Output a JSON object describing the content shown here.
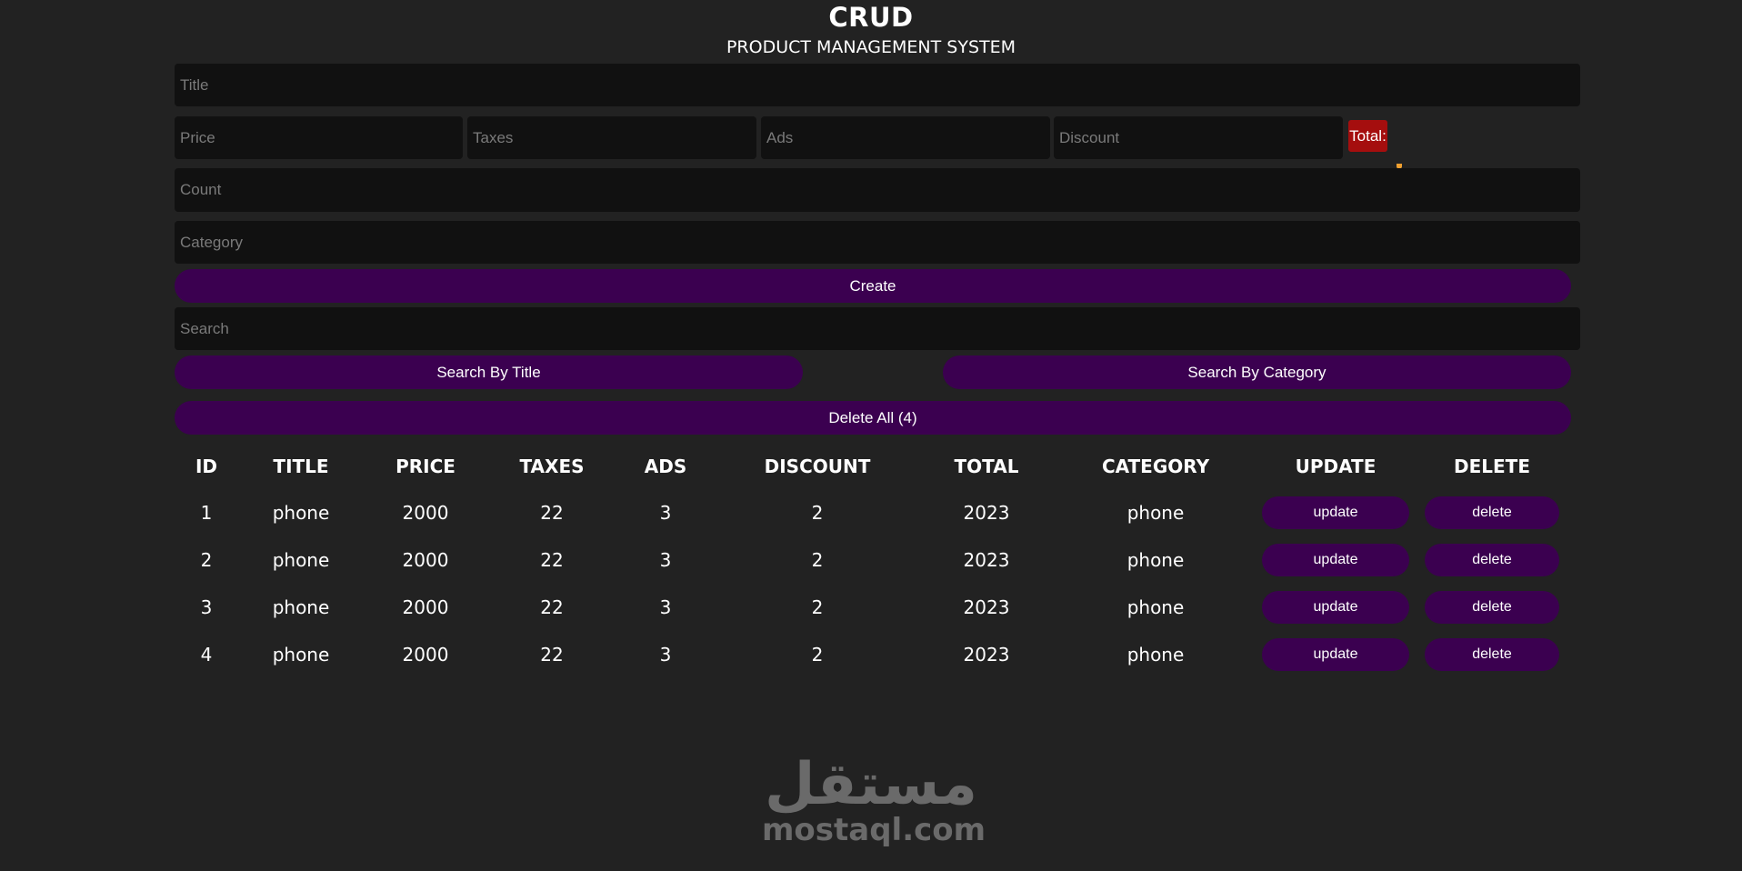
{
  "header": {
    "title": "CRUD",
    "subtitle": "PRODUCT MANAGEMENT SYSTEM"
  },
  "form": {
    "title_placeholder": "Title",
    "price_placeholder": "Price",
    "taxes_placeholder": "Taxes",
    "ads_placeholder": "Ads",
    "discount_placeholder": "Discount",
    "total_label": "Total:",
    "count_placeholder": "Count",
    "category_placeholder": "Category",
    "create_label": "Create"
  },
  "search": {
    "placeholder": "Search",
    "by_title_label": "Search By Title",
    "by_category_label": "Search By Category"
  },
  "delete_all_label": "Delete All (4)",
  "table": {
    "headers": [
      "ID",
      "TITLE",
      "PRICE",
      "TAXES",
      "ADS",
      "DISCOUNT",
      "TOTAL",
      "CATEGORY",
      "UPDATE",
      "DELETE"
    ],
    "update_label": "update",
    "delete_label": "delete",
    "rows": [
      {
        "id": "1",
        "title": "phone",
        "price": "2000",
        "taxes": "22",
        "ads": "3",
        "discount": "2",
        "total": "2023",
        "category": "phone"
      },
      {
        "id": "2",
        "title": "phone",
        "price": "2000",
        "taxes": "22",
        "ads": "3",
        "discount": "2",
        "total": "2023",
        "category": "phone"
      },
      {
        "id": "3",
        "title": "phone",
        "price": "2000",
        "taxes": "22",
        "ads": "3",
        "discount": "2",
        "total": "2023",
        "category": "phone"
      },
      {
        "id": "4",
        "title": "phone",
        "price": "2000",
        "taxes": "22",
        "ads": "3",
        "discount": "2",
        "total": "2023",
        "category": "phone"
      }
    ]
  },
  "watermark": {
    "arabic": "مستقل",
    "latin": "mostaql.com"
  },
  "colors": {
    "background": "#222222",
    "input_bg": "#111111",
    "button_bg": "#3b0050",
    "total_bg": "#a50e0e"
  }
}
